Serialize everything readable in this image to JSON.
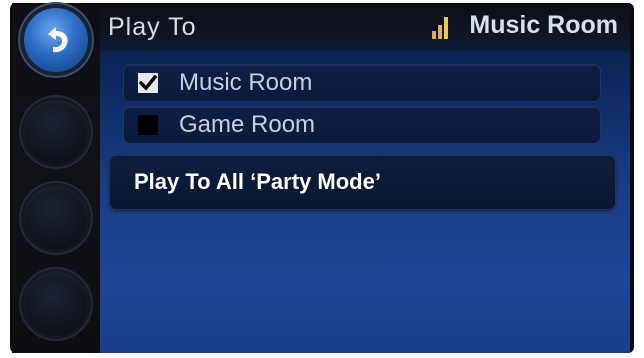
{
  "header": {
    "title": "Play To",
    "current_room": "Music Room"
  },
  "rooms": [
    {
      "label": "Music Room",
      "checked": true
    },
    {
      "label": "Game Room",
      "checked": false
    }
  ],
  "party_mode": {
    "label": "Play To All ‘Party Mode’"
  },
  "colors": {
    "accent_blue": "#2a6cc4",
    "signal_gold": "#e0b43a",
    "screen_bg": "#1a3f8a"
  },
  "icons": {
    "back": "back-arrow-icon",
    "signal": "signal-strength-icon",
    "checkbox": "checkmark-icon"
  }
}
